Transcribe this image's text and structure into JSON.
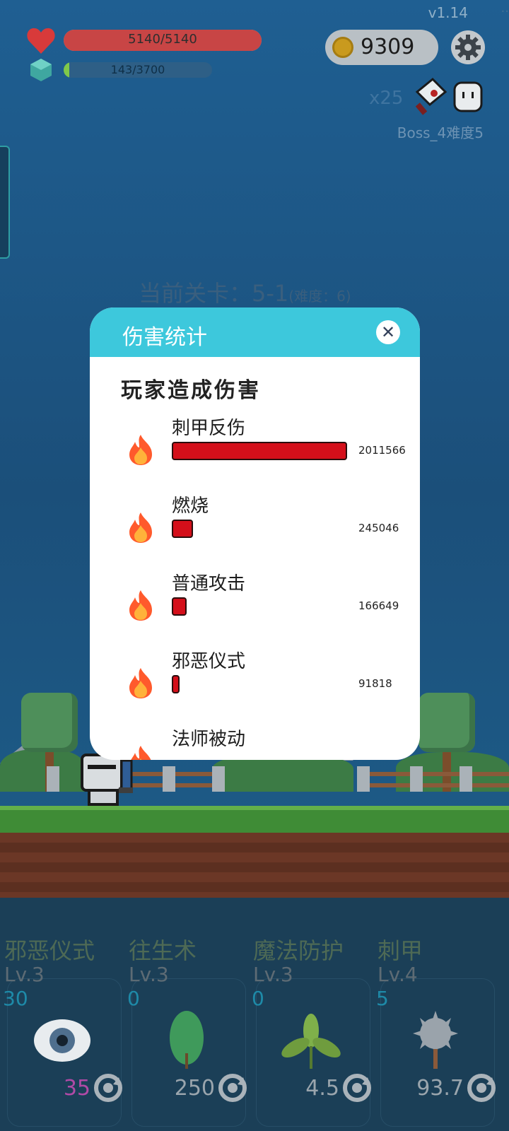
{
  "hud": {
    "version": "v1.14",
    "hp_text": "5140/5140",
    "hp_fraction": 1.0,
    "xp_text": "143/3700",
    "xp_fraction": 0.0386,
    "coins": "9309",
    "multiplier": "x25",
    "boss_label": "Boss_4难度5"
  },
  "stage": {
    "label": "当前关卡：5-1",
    "difficulty": "(难度：6)"
  },
  "modal": {
    "title": "伤害统计",
    "close_icon": "close-icon",
    "section_title": "玩家造成伤害",
    "rows": [
      {
        "name": "刺甲反伤",
        "value": "2011566",
        "fraction": 1.0
      },
      {
        "name": "燃烧",
        "value": "245046",
        "fraction": 0.122
      },
      {
        "name": "普通攻击",
        "value": "166649",
        "fraction": 0.083
      },
      {
        "name": "邪恶仪式",
        "value": "91818",
        "fraction": 0.046
      },
      {
        "name": "法师被动",
        "value": "",
        "fraction": 0
      }
    ]
  },
  "skills": [
    {
      "name": "邪恶仪式",
      "level": "Lv.3",
      "count": "30",
      "cost": "35",
      "icon": "eye-icon",
      "cost_color": "#b04aa6"
    },
    {
      "name": "往生术",
      "level": "Lv.3",
      "count": "0",
      "cost": "250",
      "icon": "leaf-icon",
      "cost_color": "#9aa5ad"
    },
    {
      "name": "魔法防护",
      "level": "Lv.3",
      "count": "0",
      "cost": "4.5",
      "icon": "sprout-icon",
      "cost_color": "#9aa5ad"
    },
    {
      "name": "刺甲",
      "level": "Lv.4",
      "count": "5",
      "cost": "93.7",
      "icon": "spiked-mace-icon",
      "cost_color": "#9aa5ad"
    }
  ],
  "colors": {
    "modal_header": "#3dc8dc",
    "damage_bar": "#d40f1a",
    "hp_fill": "#c84545",
    "xp_fill": "#7fc84a"
  }
}
